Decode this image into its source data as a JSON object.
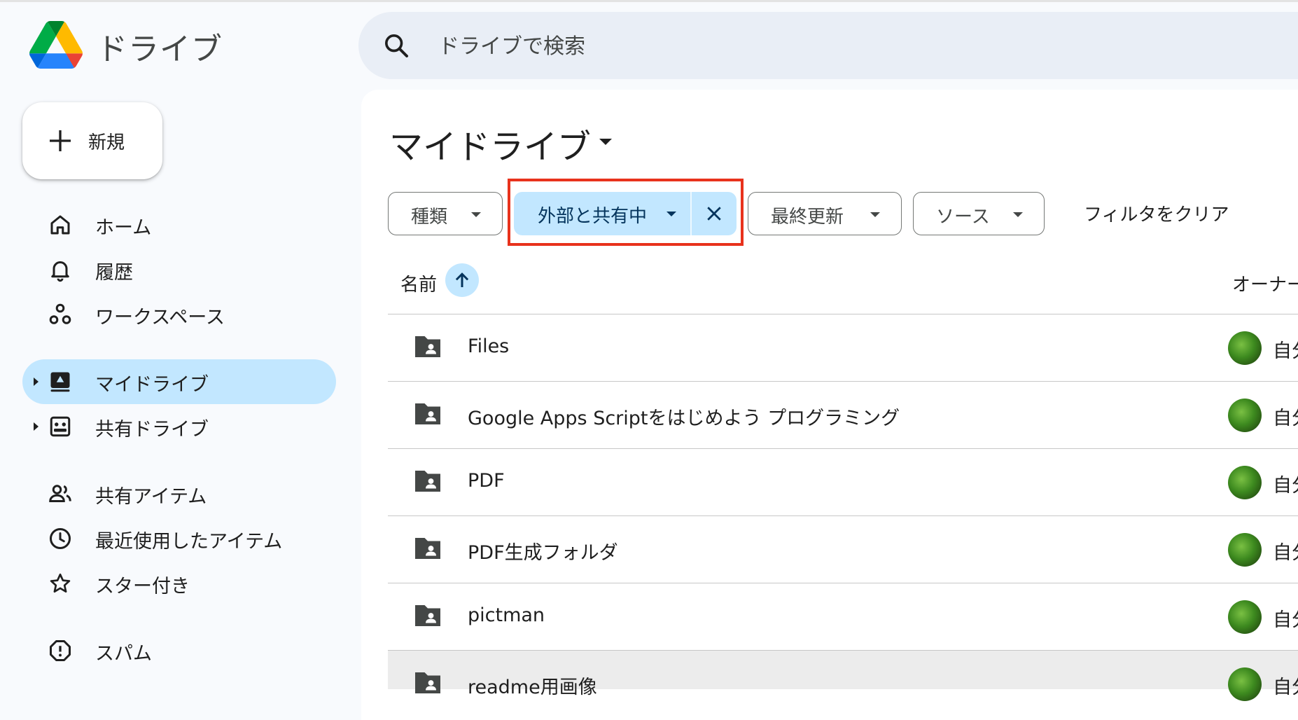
{
  "app": {
    "name": "ドライブ"
  },
  "search": {
    "placeholder": "ドライブで検索"
  },
  "sidebar": {
    "new_label": "新規",
    "items": [
      {
        "label": "ホーム",
        "icon": "home-icon"
      },
      {
        "label": "履歴",
        "icon": "bell-icon"
      },
      {
        "label": "ワークスペース",
        "icon": "workspaces-icon"
      },
      {
        "label": "マイドライブ",
        "icon": "my-drive-icon",
        "active": true
      },
      {
        "label": "共有ドライブ",
        "icon": "shared-drives-icon"
      },
      {
        "label": "共有アイテム",
        "icon": "people-icon"
      },
      {
        "label": "最近使用したアイテム",
        "icon": "clock-icon"
      },
      {
        "label": "スター付き",
        "icon": "star-icon"
      },
      {
        "label": "スパム",
        "icon": "spam-icon"
      }
    ]
  },
  "main": {
    "title": "マイドライブ",
    "filters": {
      "type": "種類",
      "shared_external": "外部と共有中",
      "modified": "最終更新",
      "source": "ソース",
      "clear": "フィルタをクリア"
    },
    "columns": {
      "name": "名前",
      "owner": "オーナー"
    },
    "rows": [
      {
        "name": "Files",
        "owner": "自分"
      },
      {
        "name": "Google Apps Scriptをはじめよう プログラミング",
        "owner": "自分"
      },
      {
        "name": "PDF",
        "owner": "自分"
      },
      {
        "name": "PDF生成フォルダ",
        "owner": "自分"
      },
      {
        "name": "pictman",
        "owner": "自分"
      },
      {
        "name": "readme用画像",
        "owner": "自分"
      }
    ]
  },
  "colors": {
    "accent": "#c2e7ff",
    "highlight": "#e8321c"
  }
}
